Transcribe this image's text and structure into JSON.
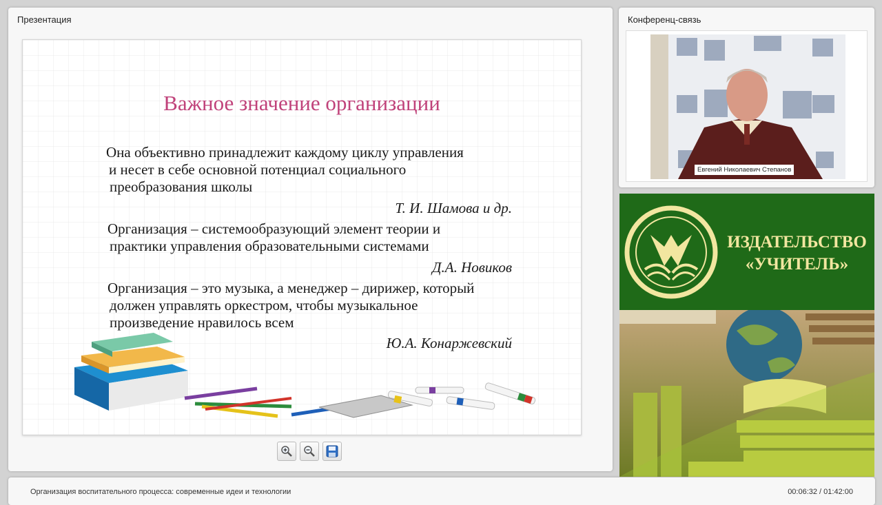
{
  "presentation": {
    "panel_title": "Презентация",
    "slide": {
      "title": "Важное значение организации",
      "quotes": [
        {
          "lines": [
            "Она объективно принадлежит каждому циклу управления",
            "и несет в себе основной потенциал социального",
            "преобразования школы"
          ],
          "author": "Т. И. Шамова и др."
        },
        {
          "lines": [
            "Организация – системообразующий элемент теории и",
            "практики управления образовательными системами"
          ],
          "author": "Д.А. Новиков"
        },
        {
          "lines": [
            "Организация – это музыка, а менеджер – дирижер, который",
            "должен управлять оркестром, чтобы музыкальное",
            "произведение нравилось всем"
          ],
          "author": "Ю.А. Конаржевский"
        }
      ]
    },
    "toolbar": {
      "zoom_in_icon": "zoom-in-icon",
      "zoom_out_icon": "zoom-out-icon",
      "save_icon": "save-icon"
    }
  },
  "video": {
    "panel_title": "Конференц-связь",
    "speaker_name": "Евгений Николаевич Степанов"
  },
  "banner": {
    "line1": "ИЗДАТЕЛЬСТВО",
    "line2": "«УЧИТЕЛЬ»",
    "colors": {
      "green": "#1f6a18",
      "gold": "#f2e6a0"
    }
  },
  "footer": {
    "course_title": "Организация воспитательного процесса: современные идеи и технологии",
    "time": "00:06:32 / 01:42:00"
  }
}
